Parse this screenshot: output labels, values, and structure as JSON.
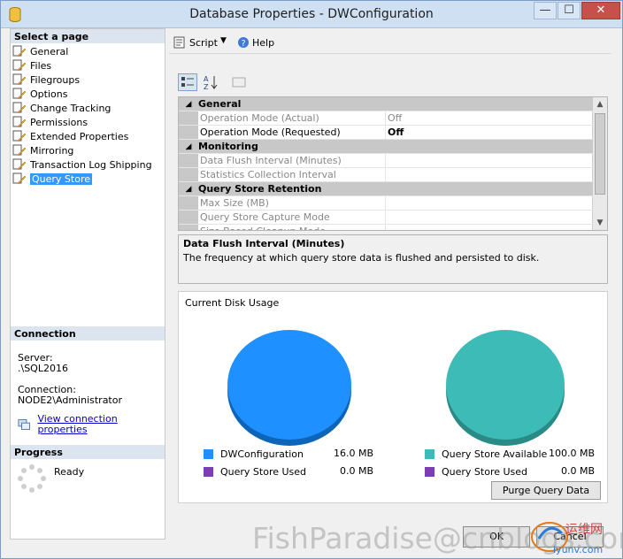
{
  "window": {
    "title": "Database Properties - DWConfiguration"
  },
  "left": {
    "select_page_heading": "Select a page",
    "pages": [
      {
        "label": "General",
        "icon": "page-icon",
        "selected": false
      },
      {
        "label": "Files",
        "icon": "page-icon",
        "selected": false
      },
      {
        "label": "Filegroups",
        "icon": "page-icon",
        "selected": false
      },
      {
        "label": "Options",
        "icon": "page-icon",
        "selected": false
      },
      {
        "label": "Change Tracking",
        "icon": "page-icon",
        "selected": false
      },
      {
        "label": "Permissions",
        "icon": "page-icon",
        "selected": false
      },
      {
        "label": "Extended Properties",
        "icon": "page-icon",
        "selected": false
      },
      {
        "label": "Mirroring",
        "icon": "page-icon",
        "selected": false
      },
      {
        "label": "Transaction Log Shipping",
        "icon": "page-icon",
        "selected": false
      },
      {
        "label": "Query Store",
        "icon": "page-icon",
        "selected": true
      }
    ],
    "connection": {
      "heading": "Connection",
      "server_label": "Server:",
      "server_value": ".\\SQL2016",
      "connection_label": "Connection:",
      "connection_value": "NODE2\\Administrator",
      "view_link": "View connection properties"
    },
    "progress": {
      "heading": "Progress",
      "status": "Ready"
    }
  },
  "toolbar": {
    "script_label": "Script",
    "help_label": "Help"
  },
  "grid": {
    "categories": [
      {
        "name": "General",
        "rows": [
          {
            "name": "Operation Mode (Actual)",
            "value": "Off",
            "emphasis": false
          },
          {
            "name": "Operation Mode (Requested)",
            "value": "Off",
            "emphasis": true
          }
        ]
      },
      {
        "name": "Monitoring",
        "rows": [
          {
            "name": "Data Flush Interval (Minutes)",
            "value": "",
            "emphasis": false
          },
          {
            "name": "Statistics Collection Interval",
            "value": "",
            "emphasis": false
          }
        ]
      },
      {
        "name": "Query Store Retention",
        "rows": [
          {
            "name": "Max Size (MB)",
            "value": "",
            "emphasis": false
          },
          {
            "name": "Query Store Capture Mode",
            "value": "",
            "emphasis": false
          },
          {
            "name": "Size Based Cleanup Mode",
            "value": "",
            "emphasis": false
          }
        ]
      }
    ]
  },
  "description": {
    "title": "Data Flush Interval (Minutes)",
    "text": "The frequency at which query store data is flushed and persisted to disk."
  },
  "disk": {
    "title": "Current Disk Usage",
    "left_legend": [
      {
        "label": "DWConfiguration",
        "value": "16.0 MB",
        "color": "#1e90ff"
      },
      {
        "label": "Query Store Used",
        "value": "0.0 MB",
        "color": "#7b3fb3"
      }
    ],
    "right_legend": [
      {
        "label": "Query Store Available",
        "value": "100.0 MB",
        "color": "#3dbbb7"
      },
      {
        "label": "Query Store Used",
        "value": "0.0 MB",
        "color": "#7b3fb3"
      }
    ],
    "purge_button": "Purge Query Data"
  },
  "buttons": {
    "ok": "OK",
    "cancel": "Cancel"
  },
  "watermark": {
    "text": "FishParadise@cnblogs.com",
    "logo_text": "运维网 iyunv.com"
  }
}
